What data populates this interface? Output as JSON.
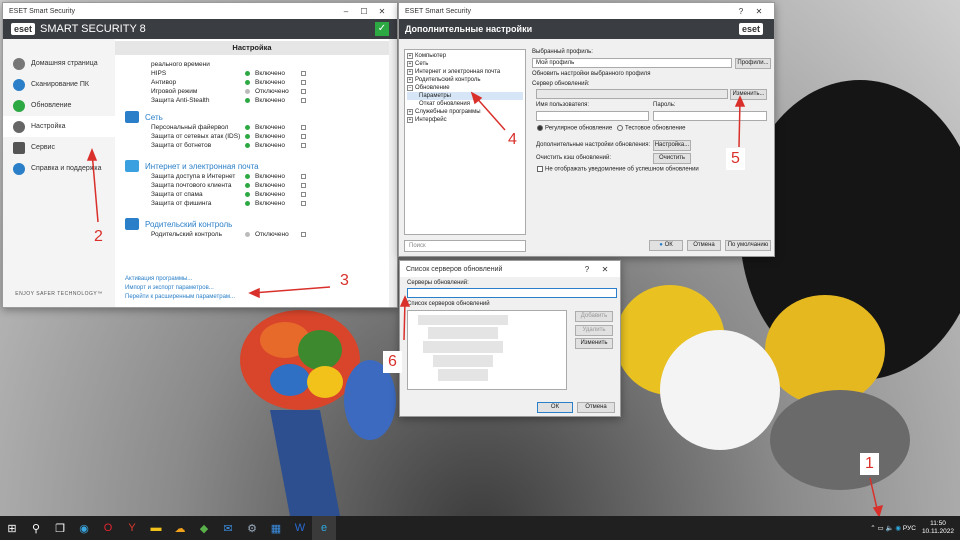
{
  "main_window": {
    "title": "ESET Smart Security",
    "brand": "eset",
    "product": "SMART SECURITY 8",
    "section_title": "Настройка",
    "nav": [
      "Домашняя страница",
      "Сканирование ПК",
      "Обновление",
      "Настройка",
      "Сервис",
      "Справка и поддержка"
    ],
    "enjoy": "ENJOY SAFER TECHNOLOGY™",
    "top_items": [
      {
        "name": "реального времени",
        "status": "",
        "on": null
      },
      {
        "name": "HIPS",
        "status": "Включено",
        "on": true
      },
      {
        "name": "Антивор",
        "status": "Включено",
        "on": true
      },
      {
        "name": "Игровой режим",
        "status": "Отключено",
        "on": false
      },
      {
        "name": "Защита Anti-Stealth",
        "status": "Включено",
        "on": true
      }
    ],
    "sections": [
      {
        "title": "Сеть",
        "items": [
          {
            "name": "Персональный файервол",
            "status": "Включено"
          },
          {
            "name": "Защита от сетевых атак (IDS)",
            "status": "Включено"
          },
          {
            "name": "Защита от ботнетов",
            "status": "Включено"
          }
        ]
      },
      {
        "title": "Интернет и электронная почта",
        "items": [
          {
            "name": "Защита доступа в Интернет",
            "status": "Включено"
          },
          {
            "name": "Защита почтового клиента",
            "status": "Включено"
          },
          {
            "name": "Защита от спама",
            "status": "Включено"
          },
          {
            "name": "Защита от фишинга",
            "status": "Включено"
          }
        ]
      },
      {
        "title": "Родительский контроль",
        "items": [
          {
            "name": "Родительский контроль",
            "status": "Отключено"
          }
        ]
      }
    ],
    "links": [
      "Активация программы...",
      "Импорт и экспорт параметров...",
      "Перейти к расширенным параметрам..."
    ]
  },
  "advanced": {
    "title": "ESET Smart Security",
    "header": "Дополнительные настройки",
    "tree": [
      "Компьютер",
      "Сеть",
      "Интернет и электронная почта",
      "Родительский контроль",
      "Обновление",
      "Параметры",
      "Откат обновления",
      "Служебные программы",
      "Интерфейс"
    ],
    "search_placeholder": "Поиск",
    "selected_profile_label": "Выбранный профиль:",
    "selected_profile": "Мой профиль",
    "profiles_btn": "Профили...",
    "update_settings_label": "Обновить настройки выбранного профиля",
    "server_label": "Сервер обновлений:",
    "change_btn": "Изменить...",
    "user_label": "Имя пользователя:",
    "password_label": "Пароль:",
    "regular": "Регулярное обновление",
    "test": "Тестовое обновление",
    "extra_label": "Дополнительные настройки обновления:",
    "setup_btn": "Настройка...",
    "cache_label": "Очистить кэш обновлений:",
    "clear_btn": "Очистить",
    "no_notify": "Не отображать уведомление об успешном обновлении",
    "ok": "ОК",
    "cancel": "Отмена",
    "default": "По умолчанию"
  },
  "servers": {
    "title": "Список серверов обновлений",
    "help": "?",
    "servers_label": "Серверы обновлений:",
    "list_label": "Список серверов обновлений",
    "add": "Добавить",
    "remove": "Удалить",
    "edit": "Изменить",
    "ok": "ОК",
    "cancel": "Отмена"
  },
  "annotations": [
    "1",
    "2",
    "3",
    "4",
    "5",
    "6"
  ],
  "taskbar": {
    "lang": "РУС",
    "time": "11:50",
    "date": "10.11.2022"
  },
  "colors": {
    "accent": "#2a7fc8",
    "ok_green": "#2da944",
    "annotation": "#d9302b",
    "header_dark": "#3a3d42"
  }
}
